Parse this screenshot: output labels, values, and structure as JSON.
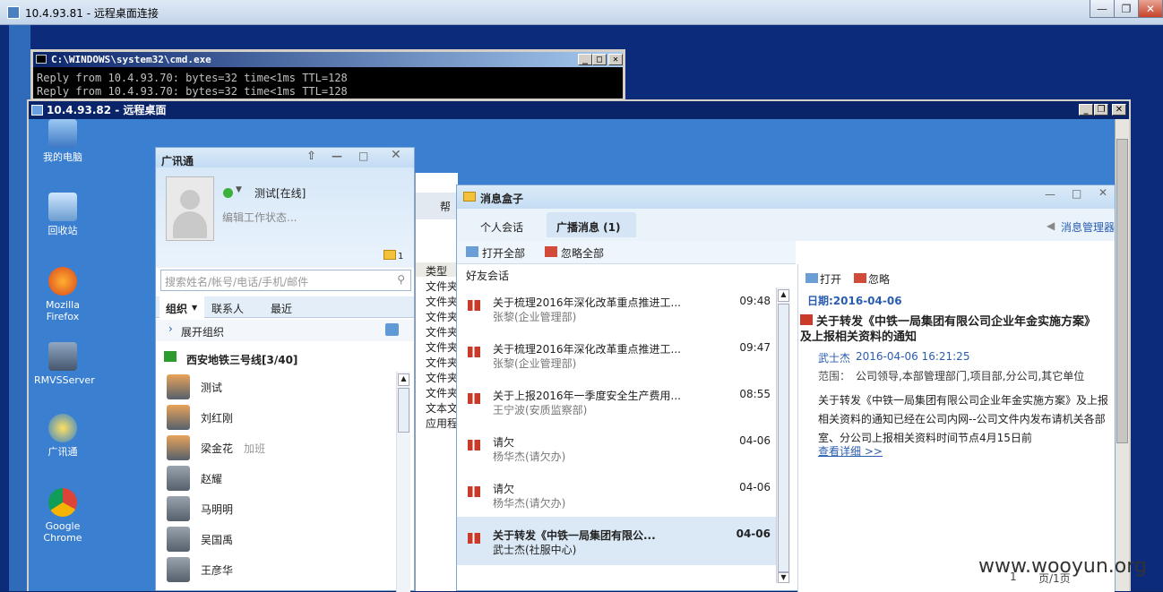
{
  "outer": {
    "title": "10.4.93.81 - 远程桌面连接"
  },
  "cmd": {
    "title": "C:\\WINDOWS\\system32\\cmd.exe",
    "lines": [
      "Reply from 10.4.93.70: bytes=32 time<1ms TTL=128",
      "Reply from 10.4.93.70: bytes=32 time<1ms TTL=128"
    ]
  },
  "inner": {
    "title": "10.4.93.82 - 远程桌面"
  },
  "desktop": {
    "icons": [
      "我的电脑",
      "回收站",
      "Mozilla Firefox",
      "RMVSServer",
      "广讯通",
      "Google Chrome"
    ]
  },
  "gxt": {
    "title": "广讯通",
    "status": "测试[在线]",
    "signature": "编辑工作状态...",
    "badge_count": "1",
    "search_placeholder": "搜索姓名/帐号/电话/手机/邮件",
    "tabs": [
      "组织",
      "联系人",
      "最近"
    ],
    "expand": "展开组织",
    "group": "西安地铁三号线[3/40]",
    "contacts": [
      {
        "name": "测试",
        "note": ""
      },
      {
        "name": "刘红刚",
        "note": ""
      },
      {
        "name": "梁金花",
        "note": "加班"
      },
      {
        "name": "赵耀",
        "note": ""
      },
      {
        "name": "马明明",
        "note": ""
      },
      {
        "name": "吴国禹",
        "note": ""
      },
      {
        "name": "王彦华",
        "note": ""
      }
    ]
  },
  "mid": {
    "labels": [
      "帮",
      "类型",
      "文件夹",
      "文件夹",
      "文件夹",
      "文件夹",
      "文件夹",
      "文件夹",
      "文件夹",
      "文件夹",
      "文本文",
      "应用程"
    ]
  },
  "msg": {
    "title": "消息盒子",
    "tabs": [
      "个人会话",
      "广播消息 (1)"
    ],
    "manager": "消息管理器",
    "open_all": "打开全部",
    "ignore_all": "忽略全部",
    "section": "好友会话",
    "items": [
      {
        "title": "关于梳理2016年深化改革重点推进工...",
        "sub": "张黎(企业管理部)",
        "time": "09:48",
        "bold": false
      },
      {
        "title": "关于梳理2016年深化改革重点推进工...",
        "sub": "张黎(企业管理部)",
        "time": "09:47",
        "bold": false
      },
      {
        "title": "关于上报2016年一季度安全生产费用...",
        "sub": "王宁波(安质监察部)",
        "time": "08:55",
        "bold": false
      },
      {
        "title": "请欠",
        "sub": "杨华杰(请欠办)",
        "time": "04-06",
        "bold": false
      },
      {
        "title": "请欠",
        "sub": "杨华杰(请欠办)",
        "time": "04-06",
        "bold": false
      },
      {
        "title": "关于转发《中铁一局集团有限公...",
        "sub": "武士杰(社服中心)",
        "time": "04-06",
        "bold": true
      }
    ],
    "detail": {
      "open": "打开",
      "ignore": "忽略",
      "date": "日期:2016-04-06",
      "heading": "关于转发《中铁一局集团有限公司企业年金实施方案》及上报相关资料的通知",
      "author": "武士杰",
      "datetime": "2016-04-06 16:21:25",
      "scope_label": "范围：",
      "scope": "公司领导,本部管理部门,项目部,分公司,其它单位",
      "body": "关于转发《中铁一局集团有限公司企业年金实施方案》及上报相关资料的通知已经在公司内网--公司文件内发布请机关各部室、分公司上报相关资料时间节点4月15日前",
      "more": "查看详细 >>",
      "pager": "页/1页",
      "page": "1"
    }
  },
  "watermark": "www.wooyun.org"
}
